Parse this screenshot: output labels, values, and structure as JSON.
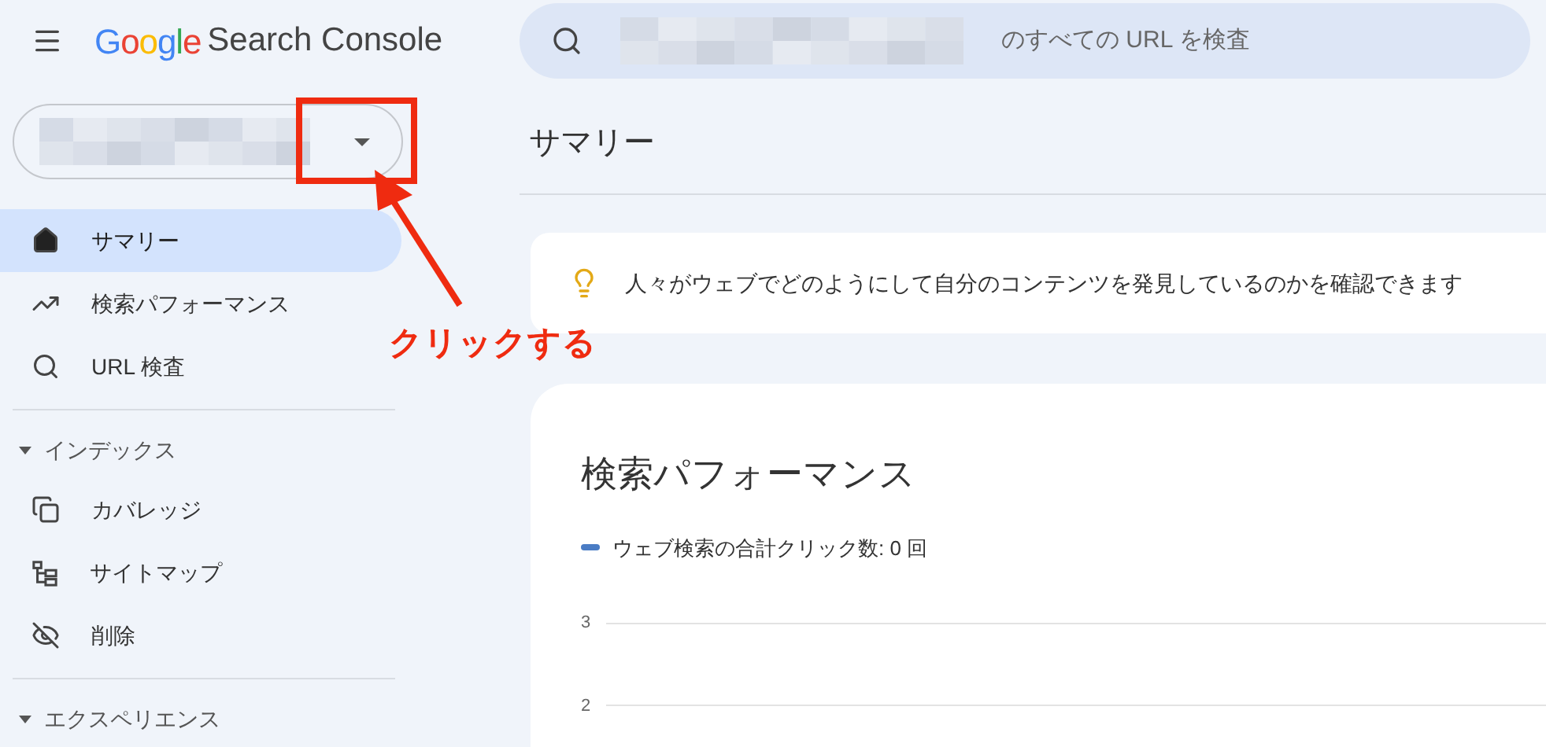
{
  "header": {
    "brand": "Google",
    "product": "Search Console",
    "search": {
      "placeholder": "のすべての URL を検査"
    }
  },
  "property_selector": {
    "expanded": false
  },
  "sidebar": {
    "items": [
      {
        "kind": "home",
        "label": "サマリー",
        "selected": true
      },
      {
        "kind": "trend",
        "label": "検索パフォーマンス",
        "selected": false
      },
      {
        "kind": "search",
        "label": "URL 検査",
        "selected": false
      }
    ],
    "sections": [
      {
        "title": "インデックス",
        "expanded": true,
        "items": [
          {
            "kind": "copy",
            "label": "カバレッジ",
            "selected": false
          },
          {
            "kind": "sitemap",
            "label": "サイトマップ",
            "selected": false
          },
          {
            "kind": "eye-off",
            "label": "削除",
            "selected": false
          }
        ]
      },
      {
        "title": "エクスペリエンス",
        "expanded": true
      }
    ]
  },
  "page_title": "サマリー",
  "tip": {
    "text": "人々がウェブでどのようにして自分のコンテンツを発見しているのかを確認できます"
  },
  "performance_card": {
    "title": "検索パフォーマンス",
    "legend": {
      "label": "ウェブ検索の合計クリック数: 0 回",
      "color": "#4a7cc4"
    },
    "y_axis_labels": [
      "3",
      "2"
    ]
  },
  "annotation": {
    "label": "クリックする"
  }
}
